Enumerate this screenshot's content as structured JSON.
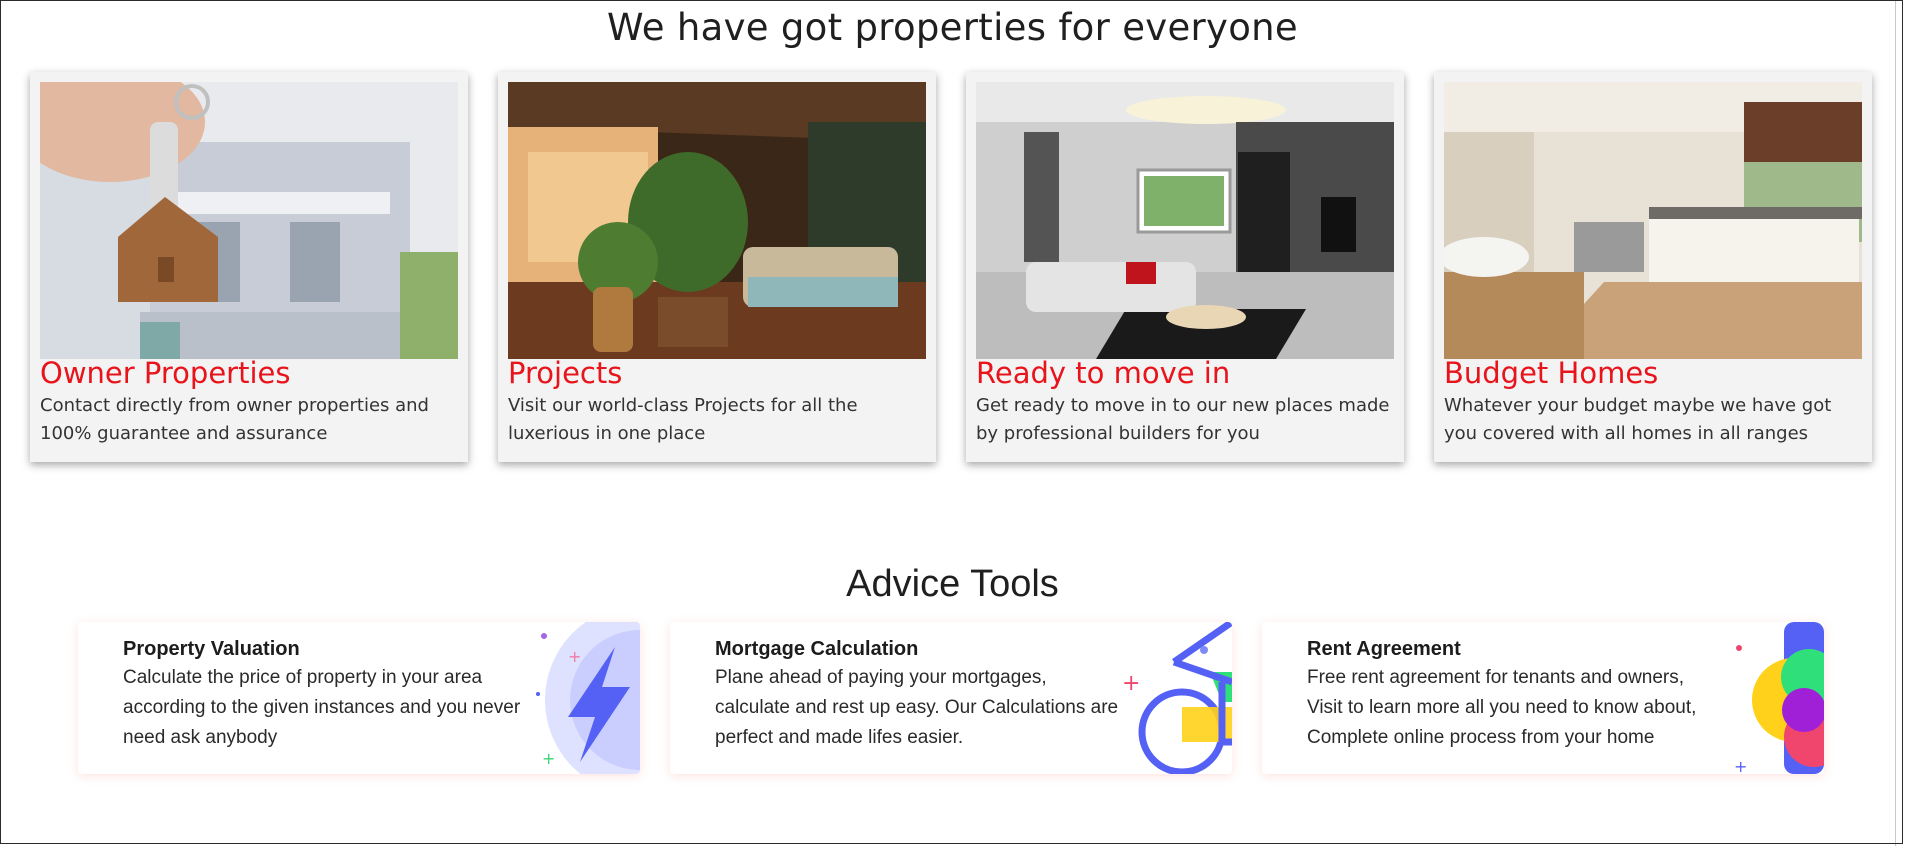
{
  "properties_section": {
    "title": "We have got properties for everyone",
    "cards": [
      {
        "name": "Owner Properties",
        "description": "Contact directly from owner properties and 100% guarantee and assurance"
      },
      {
        "name": "Projects",
        "description": "Visit our world-class Projects for all the luxerious in one place"
      },
      {
        "name": "Ready to move in",
        "description": "Get ready to move in to our new places made by professional builders for you"
      },
      {
        "name": "Budget Homes",
        "description": "Whatever your budget maybe we have got you covered with all homes in all ranges"
      }
    ]
  },
  "advice_section": {
    "title": "Advice Tools",
    "tools": [
      {
        "name": "Property Valuation",
        "description": "Calculate the price of property in your area according to the given instances and you never need ask anybody",
        "icon": "lightning-icon"
      },
      {
        "name": "Mortgage Calculation",
        "description": "Plane ahead of paying your mortgages, calculate and rest up easy. Our Calculations are perfect and made lifes easier.",
        "icon": "bicycle-icon"
      },
      {
        "name": "Rent Agreement",
        "description": "Free rent agreement for tenants and owners, Visit to learn more all you need to know about, Complete online process from your home",
        "icon": "circles-icon"
      }
    ]
  },
  "colors": {
    "accent_red": "#e8141b",
    "card_bg": "#f3f3f3",
    "icon_blue": "#5561f5"
  }
}
